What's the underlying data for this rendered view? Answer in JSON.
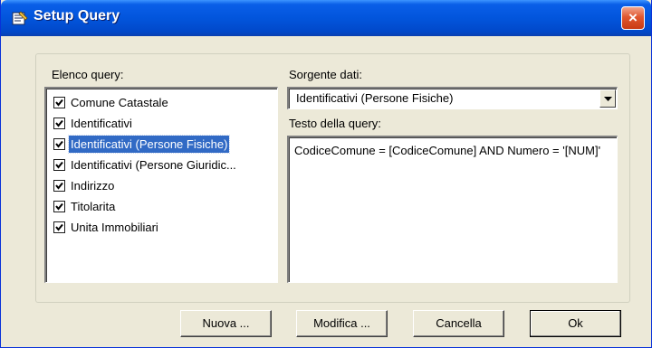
{
  "window": {
    "title": "Setup Query",
    "close_label": "×"
  },
  "left_panel": {
    "label": "Elenco query:",
    "items": [
      {
        "label": "Comune Catastale",
        "checked": true,
        "selected": false
      },
      {
        "label": "Identificativi",
        "checked": true,
        "selected": false
      },
      {
        "label": "Identificativi (Persone Fisiche)",
        "checked": true,
        "selected": true
      },
      {
        "label": "Identificativi (Persone Giuridic...",
        "checked": true,
        "selected": false
      },
      {
        "label": "Indirizzo",
        "checked": true,
        "selected": false
      },
      {
        "label": "Titolarita",
        "checked": true,
        "selected": false
      },
      {
        "label": "Unita Immobiliari",
        "checked": true,
        "selected": false
      }
    ]
  },
  "right_panel": {
    "source_label": "Sorgente dati:",
    "source_value": "Identificativi (Persone Fisiche)",
    "query_label": "Testo della query:",
    "query_text": "CodiceComune = [CodiceComune] AND Numero = '[NUM]'"
  },
  "buttons": {
    "new": "Nuova ...",
    "edit": "Modifica ...",
    "delete": "Cancella",
    "ok": "Ok"
  },
  "colors": {
    "titlebar": "#0255dc",
    "selection": "#316ac5",
    "dialog_bg": "#ece9d8"
  }
}
